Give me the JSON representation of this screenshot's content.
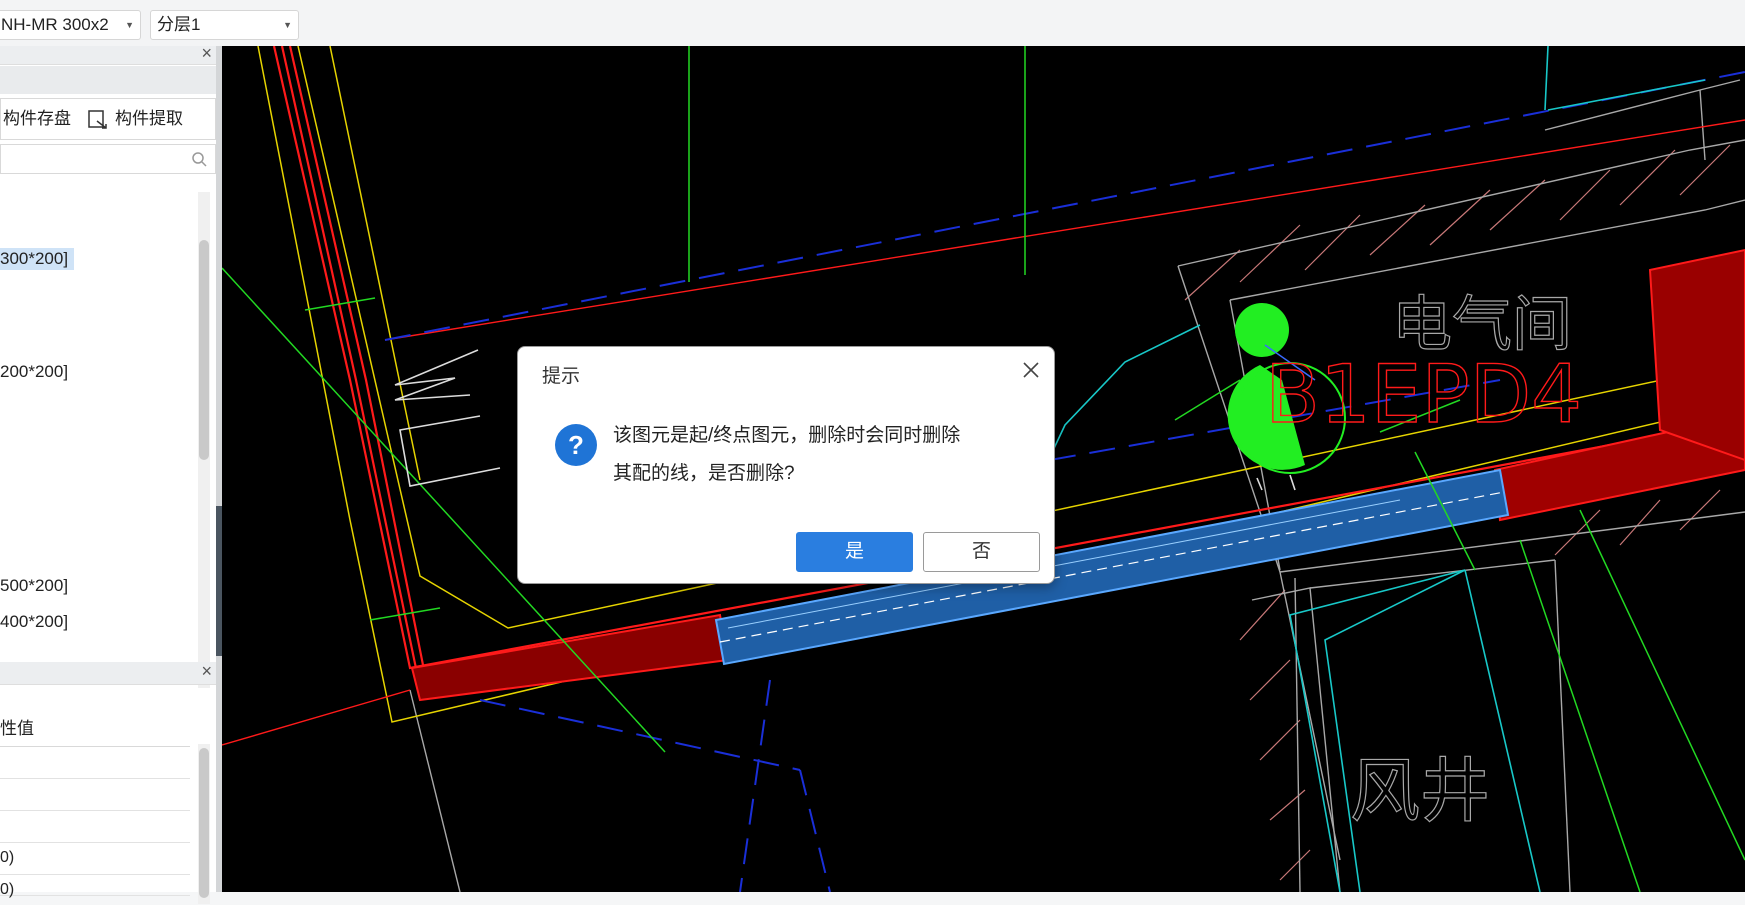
{
  "toolbar": {
    "spec_value": "NH-MR 300x2",
    "layer_value": "分层1"
  },
  "component_panel": {
    "save_label": "构件存盘",
    "extract_label": "构件提取",
    "items": [
      {
        "label": "300*200]"
      },
      {
        "label": "200*200]"
      },
      {
        "label": "500*200]"
      },
      {
        "label": "400*200]"
      }
    ]
  },
  "property_panel": {
    "header": "性值",
    "rows": [
      "",
      "",
      "",
      "0)",
      "0)"
    ]
  },
  "drawing": {
    "label_room": "电气间",
    "label_panel": "B1EPD4",
    "label_shaft": "风井"
  },
  "dialog": {
    "title": "提示",
    "message_line1": "该图元是起/终点图元，删除时会同时删除",
    "message_line2": "其配的线，是否删除?",
    "yes_label": "是",
    "no_label": "否",
    "icon": "question-icon",
    "accent": "#2a7ee0"
  }
}
